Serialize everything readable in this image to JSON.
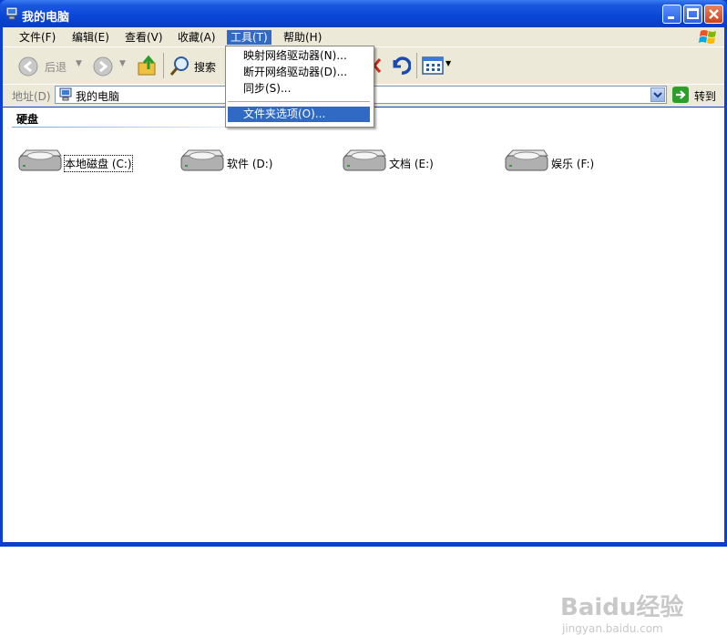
{
  "window": {
    "title": "我的电脑"
  },
  "menubar": {
    "items": [
      {
        "label": "文件(F)"
      },
      {
        "label": "编辑(E)"
      },
      {
        "label": "查看(V)"
      },
      {
        "label": "收藏(A)"
      },
      {
        "label": "工具(T)"
      },
      {
        "label": "帮助(H)"
      }
    ]
  },
  "toolbar": {
    "back_label": "后退",
    "search_label": "搜索"
  },
  "address": {
    "label": "地址(D)",
    "value": "我的电脑",
    "go_label": "转到"
  },
  "tools_menu": {
    "items": [
      {
        "label": "映射网络驱动器(N)..."
      },
      {
        "label": "断开网络驱动器(D)..."
      },
      {
        "label": "同步(S)..."
      },
      {
        "label": "文件夹选项(O)..."
      }
    ]
  },
  "content": {
    "section_title": "硬盘",
    "drives": [
      {
        "label": "本地磁盘 (C:)"
      },
      {
        "label": "软件 (D:)"
      },
      {
        "label": "文档 (E:)"
      },
      {
        "label": "娱乐 (F:)"
      }
    ]
  },
  "watermark": {
    "brand": "Baidu经验",
    "url": "jingyan.baidu.com"
  }
}
